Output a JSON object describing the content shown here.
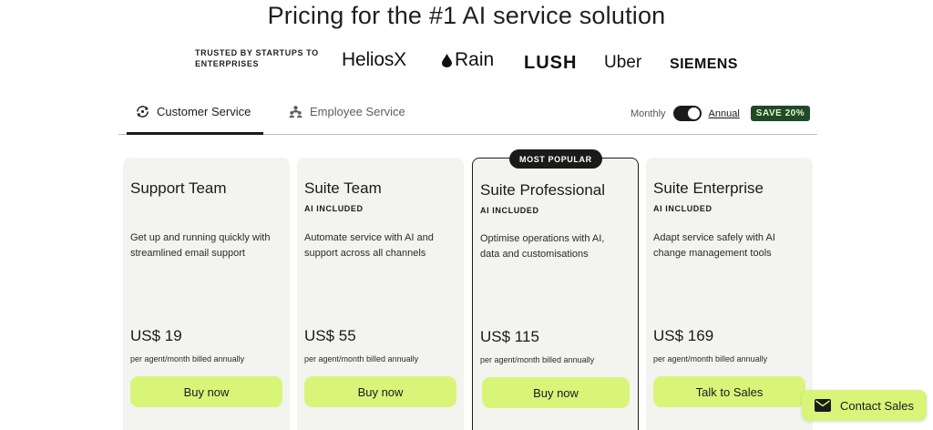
{
  "header": {
    "title": "Pricing for the #1 AI service solution"
  },
  "trust": {
    "label": "TRUSTED BY STARTUPS TO ENTERPRISES",
    "logos": [
      "HeliosX",
      "Rain",
      "LUSH",
      "Uber",
      "SIEMENS"
    ]
  },
  "tabs": [
    {
      "label": "Customer Service",
      "icon": "customer-service-icon",
      "active": true
    },
    {
      "label": "Employee Service",
      "icon": "employee-service-icon",
      "active": false
    }
  ],
  "billing": {
    "monthly_label": "Monthly",
    "annual_label": "Annual",
    "save_label": "SAVE 20%",
    "selected": "Annual"
  },
  "plans": [
    {
      "name": "Support Team",
      "tag": "",
      "description": "Get up and running quickly with streamlined email support",
      "price": "US$ 19",
      "billing_note": "per agent/month billed annually",
      "cta": "Buy now"
    },
    {
      "name": "Suite Team",
      "tag": "AI INCLUDED",
      "description": "Automate service with AI and support across all channels",
      "price": "US$ 55",
      "billing_note": "per agent/month billed annually",
      "cta": "Buy now"
    },
    {
      "name": "Suite Professional",
      "tag": "AI INCLUDED",
      "description": "Optimise operations with AI, data and customisations",
      "price": "US$ 115",
      "billing_note": "per agent/month billed annually",
      "cta": "Buy now",
      "badge": "MOST POPULAR"
    },
    {
      "name": "Suite Enterprise",
      "tag": "AI INCLUDED",
      "description": "Adapt service safely with AI change management tools",
      "price": "US$ 169",
      "billing_note": "per agent/month billed annually",
      "cta": "Talk to Sales"
    }
  ],
  "contact": {
    "label": "Contact Sales",
    "icon": "mail-icon"
  },
  "colors": {
    "accent": "#d8f57a",
    "save_badge_bg": "#1f4a2a",
    "card_bg": "#f3f3ef",
    "dark": "#1a1a1a"
  }
}
